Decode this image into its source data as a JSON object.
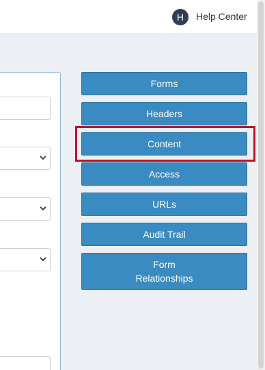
{
  "header": {
    "avatar_initial": "H",
    "help_center_label": "Help Center"
  },
  "sidebar": {
    "buttons": [
      {
        "label": "Forms"
      },
      {
        "label": "Headers"
      },
      {
        "label": "Content"
      },
      {
        "label": "Access"
      },
      {
        "label": "URLs"
      },
      {
        "label": "Audit Trail"
      },
      {
        "label_line1": "Form",
        "label_line2": "Relationships"
      }
    ],
    "highlighted_item": "Content"
  },
  "colors": {
    "button_bg": "#3a8bc1",
    "highlight": "#b8142c",
    "page_bg": "#eceff3"
  }
}
